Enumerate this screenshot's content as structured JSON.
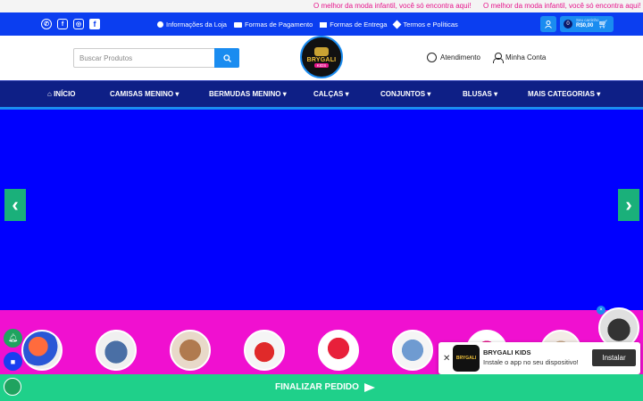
{
  "marquee": {
    "text_1": "O melhor da moda infantil, você só encontra aqui!",
    "text_2": "O melhor da moda infantil, você só encontra aqui!"
  },
  "topbar": {
    "social": [
      "whatsapp-icon",
      "ifood-icon",
      "instagram-icon",
      "facebook-icon"
    ],
    "links": [
      {
        "label": "Informações da Loja",
        "icon": "info-icon"
      },
      {
        "label": "Formas de Pagamento",
        "icon": "credit-card-icon"
      },
      {
        "label": "Formas de Entrega",
        "icon": "truck-icon"
      },
      {
        "label": "Termos e Políticas",
        "icon": "gear-icon"
      }
    ],
    "cart": {
      "count": "0",
      "label": "Seu carrinho",
      "total": "R$0,00"
    }
  },
  "header": {
    "search_placeholder": "Buscar Produtos",
    "logo_brand": "BRYGALI",
    "logo_sub": "KIDS",
    "atendimento": "Atendimento",
    "minha_conta": "Minha Conta"
  },
  "nav": {
    "items": [
      {
        "label": "INÍCIO",
        "dropdown": false
      },
      {
        "label": "CAMISAS MENINO",
        "dropdown": true
      },
      {
        "label": "BERMUDAS MENINO",
        "dropdown": true
      },
      {
        "label": "CALÇAS",
        "dropdown": true
      },
      {
        "label": "CONJUNTOS",
        "dropdown": true
      },
      {
        "label": "BLUSAS",
        "dropdown": true
      },
      {
        "label": "MAIS CATEGORIAS",
        "dropdown": true
      }
    ]
  },
  "hero": {
    "color": "#0000ff"
  },
  "install_banner": {
    "app_name": "BRYGALI KIDS",
    "description": "Instale o app no seu dispositivo!",
    "button": "Instalar"
  },
  "bottom_bar": {
    "label": "FINALIZAR PEDIDO"
  },
  "colors": {
    "primary_blue": "#0b3ef0",
    "nav_navy": "#0e1f86",
    "accent_pink": "#f010d0",
    "finalizar_green": "#1fd08a"
  }
}
